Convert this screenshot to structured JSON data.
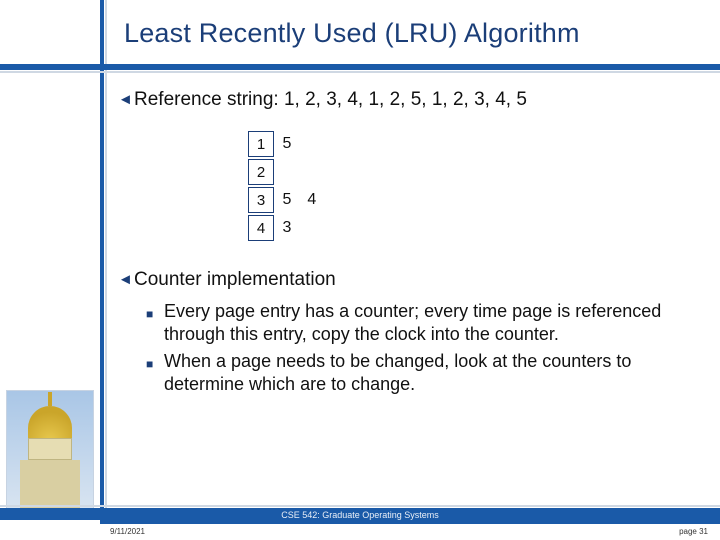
{
  "title": "Least Recently Used (LRU) Algorithm",
  "refline": "Reference string:  1, 2, 3, 4, 1, 2, 5, 1, 2, 3, 4, 5",
  "frames": [
    {
      "cell": "1",
      "beside": [
        "5"
      ]
    },
    {
      "cell": "2",
      "beside": []
    },
    {
      "cell": "3",
      "beside": [
        "5",
        "4"
      ]
    },
    {
      "cell": "4",
      "beside": [
        "3"
      ]
    }
  ],
  "counterHeading": "Counter implementation",
  "sub1": "Every page entry has a counter; every time page is referenced through this entry, copy the clock into the counter.",
  "sub2": "When a page needs to be changed, look at the counters to determine which are to change.",
  "footer": {
    "date": "9/11/2021",
    "course": "CSE 542: Graduate Operating Systems",
    "page": "page 31"
  }
}
